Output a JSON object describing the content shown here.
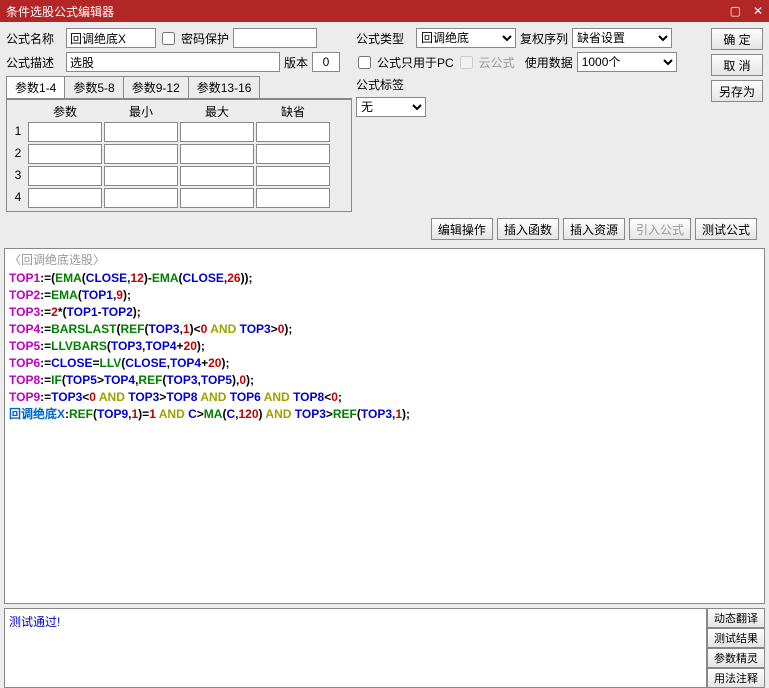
{
  "window": {
    "title": "条件选股公式编辑器",
    "min_icon": "▢",
    "close_icon": "✕"
  },
  "labels": {
    "formula_name": "公式名称",
    "pwd_protect": "密码保护",
    "formula_type": "公式类型",
    "weight_seq": "复权序列",
    "formula_desc": "公式描述",
    "version": "版本",
    "pc_only": "公式只用于PC",
    "cloud": "云公式",
    "use_data": "使用数据",
    "formula_tag": "公式标签"
  },
  "values": {
    "formula_name": "回调绝底X",
    "formula_type": "回调绝底",
    "weight_seq": "缺省设置",
    "formula_desc": "选股",
    "version": "0",
    "use_data": "1000个",
    "formula_tag": "无"
  },
  "buttons": {
    "ok": "确 定",
    "cancel": "取 消",
    "save_as": "另存为",
    "edit_op": "编辑操作",
    "insert_fn": "插入函数",
    "insert_res": "插入资源",
    "import_formula": "引入公式",
    "test_formula": "测试公式",
    "dyn_trans": "动态翻译",
    "test_result": "测试结果",
    "param_wizard": "参数精灵",
    "usage": "用法注释"
  },
  "tabs": [
    "参数1-4",
    "参数5-8",
    "参数9-12",
    "参数13-16"
  ],
  "param_headers": [
    "参数",
    "最小",
    "最大",
    "缺省"
  ],
  "param_rows": [
    "1",
    "2",
    "3",
    "4"
  ],
  "code_title": "〈回调绝底选股〉",
  "message": "测试通过!"
}
